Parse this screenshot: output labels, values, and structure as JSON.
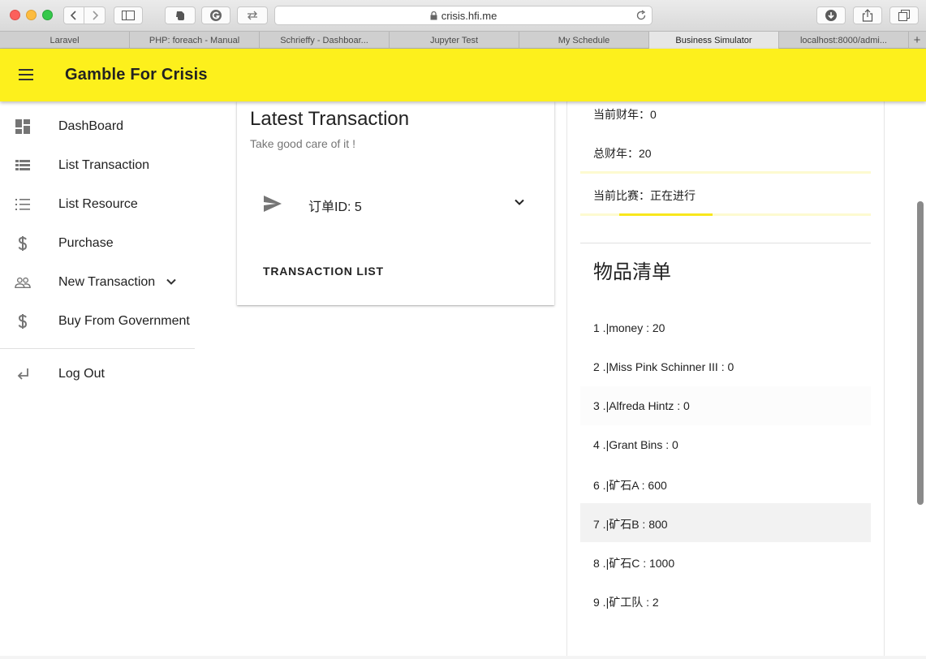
{
  "browser": {
    "url": "crisis.hfi.me",
    "tabs": [
      {
        "label": "Laravel",
        "active": false
      },
      {
        "label": "PHP: foreach - Manual",
        "active": false
      },
      {
        "label": "Schrieffy - Dashboar...",
        "active": false
      },
      {
        "label": "Jupyter Test",
        "active": false
      },
      {
        "label": "My Schedule",
        "active": false
      },
      {
        "label": "Business Simulator",
        "active": true
      },
      {
        "label": "localhost:8000/admi...",
        "active": false
      }
    ],
    "new_tab": "+"
  },
  "app": {
    "title": "Gamble For Crisis",
    "accent_color": "#fdf01c"
  },
  "sidebar": {
    "items": [
      {
        "label": "DashBoard",
        "icon": "dashboard-icon"
      },
      {
        "label": "List Transaction",
        "icon": "view-list-icon"
      },
      {
        "label": "List Resource",
        "icon": "format-list-numbered-icon"
      },
      {
        "label": "Purchase",
        "icon": "dollar-icon"
      },
      {
        "label": "New Transaction",
        "icon": "people-icon",
        "expandable": true
      },
      {
        "label": "Buy From Government",
        "icon": "dollar-icon"
      }
    ],
    "logout": {
      "label": "Log Out",
      "icon": "keyboard-return-icon"
    }
  },
  "latest_transaction": {
    "title": "Latest Transaction",
    "subtitle": "Take good care of it !",
    "order_label": "订单ID: 5",
    "action": "TRANSACTION LIST"
  },
  "game_status": {
    "current_year": "当前财年：0",
    "total_years": "总财年：20",
    "match_status": "当前比赛：正在进行"
  },
  "inventory": {
    "title": "物品清单",
    "items": [
      "1 .|money : 20",
      "2 .|Miss Pink Schinner III : 0",
      "3 .|Alfreda Hintz : 0",
      "4 .|Grant Bins : 0",
      "6 .|矿石A : 600",
      "7 .|矿石B : 800",
      "8 .|矿石C : 1000",
      "9 .|矿工队 : 2"
    ]
  }
}
